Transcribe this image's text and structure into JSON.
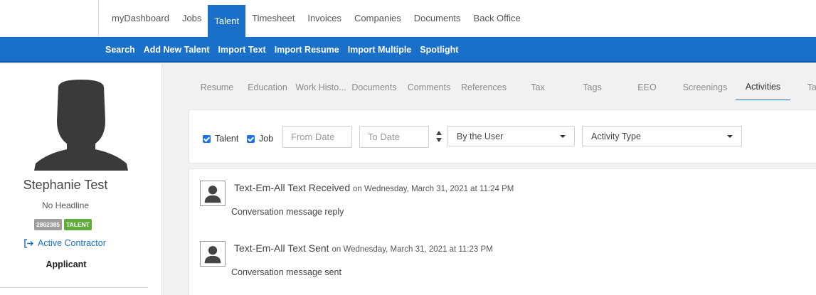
{
  "top_nav": [
    "myDashboard",
    "Jobs",
    "Talent",
    "Timesheet",
    "Invoices",
    "Companies",
    "Documents",
    "Back Office"
  ],
  "top_nav_active": "Talent",
  "sub_nav": [
    "Search",
    "Add New Talent",
    "Import Text",
    "Import Resume",
    "Import Multiple",
    "Spotlight"
  ],
  "profile": {
    "name": "Stephanie Test",
    "headline": "No Headline",
    "id_badge": "2862385",
    "type_badge": "TALENT",
    "status": "Active Contractor",
    "role": "Applicant"
  },
  "tabs": [
    "Resume",
    "Education",
    "Work Histo...",
    "Documents",
    "Comments",
    "References",
    "Tax",
    "Tags",
    "EEO",
    "Screenings",
    "Activities",
    "Ta"
  ],
  "active_tab": "Activities",
  "filters": {
    "talent_label": "Talent",
    "job_label": "Job",
    "talent_checked": true,
    "job_checked": true,
    "from_placeholder": "From Date",
    "to_placeholder": "To Date",
    "user_select": "By the User",
    "type_select": "Activity Type"
  },
  "activities": [
    {
      "title": "Text-Em-All Text Received",
      "when": "on Wednesday, March 31, 2021 at 11:24 PM",
      "message": "Conversation message reply"
    },
    {
      "title": "Text-Em-All Text Sent",
      "when": "on Wednesday, March 31, 2021 at 11:23 PM",
      "message": "Conversation message sent"
    }
  ],
  "colors": {
    "brand": "#1a6fc9",
    "badge_talent": "#5fae3c",
    "badge_id": "#9e9e9e"
  }
}
